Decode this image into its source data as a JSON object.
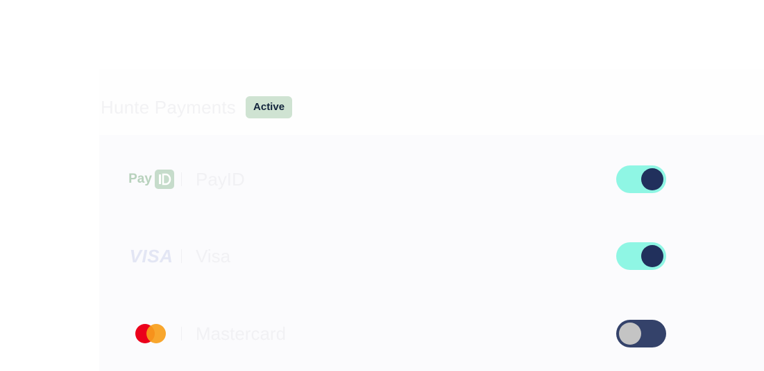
{
  "section": {
    "title": "Hunte Payments",
    "status_badge": "Active"
  },
  "payment_methods": [
    {
      "name": "PayID",
      "logo": "payid-logo",
      "logo_text": "Pay",
      "enabled": true
    },
    {
      "name": "Visa",
      "logo": "visa-logo",
      "logo_text": "VISA",
      "enabled": true
    },
    {
      "name": "Mastercard",
      "logo": "mastercard-logo",
      "enabled": false
    }
  ],
  "colors": {
    "badge_bg": "#cfe3d2",
    "toggle_on_track": "#8ff6e4",
    "toggle_on_knob": "#21305c",
    "toggle_off_track": "#34426a",
    "toggle_off_knob": "#c4c4c4"
  }
}
